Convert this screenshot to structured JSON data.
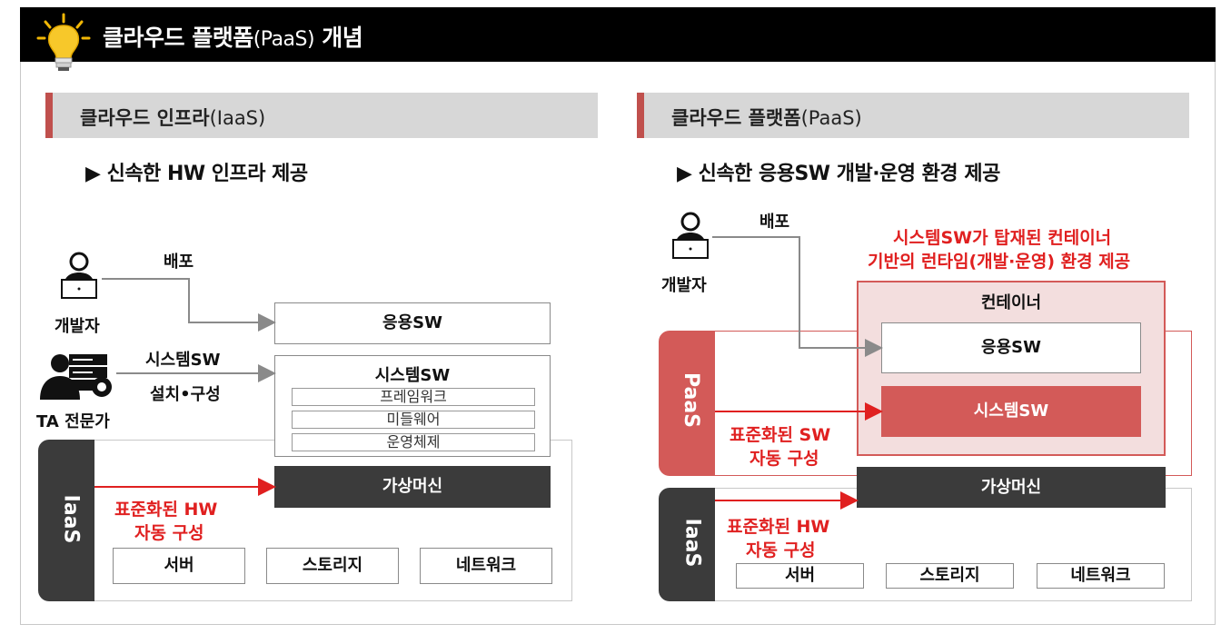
{
  "title": {
    "main": "클라우드 플랫폼",
    "suffix": "(PaaS)",
    "tail": " 개념"
  },
  "left": {
    "header_main": "클라우드 인프라",
    "header_suffix": "(IaaS)",
    "bullet": "▶ 신속한 HW 인프라 제공",
    "developer_label": "개발자",
    "deploy_label": "배포",
    "ta_label": "TA 전문가",
    "sysw_install_line1": "시스템SW",
    "sysw_install_line2": "설치•구성",
    "app_sw": "응용SW",
    "system_sw": "시스템SW",
    "sub_items": [
      "프레임워크",
      "미들웨어",
      "운영체제"
    ],
    "vm": "가상머신",
    "std_line1": "표준화된 HW",
    "std_line2": "자동 구성",
    "iaas_tab": "IaaS",
    "hw": [
      "서버",
      "스토리지",
      "네트워크"
    ]
  },
  "right": {
    "header_main": "클라우드 플랫폼",
    "header_suffix": "(PaaS)",
    "bullet": "▶ 신속한 응용SW 개발·운영 환경 제공",
    "deploy_label": "배포",
    "developer_label": "개발자",
    "note_line1": "시스템SW가 탑재된 컨테이너",
    "note_line2": "기반의 런타임(개발·운영) 환경 제공",
    "container": "컨테이너",
    "app_sw": "응용SW",
    "system_sw": "시스템SW",
    "paas_tab": "PaaS",
    "std_sw_line1": "표준화된 SW",
    "std_sw_line2": "자동 구성",
    "vm": "가상머신",
    "iaas_tab": "IaaS",
    "std_hw_line1": "표준화된 HW",
    "std_hw_line2": "자동 구성",
    "hw": [
      "서버",
      "스토리지",
      "네트워크"
    ]
  },
  "colors": {
    "accent": "#c0504d",
    "red_text": "#e02020",
    "dark": "#3b3b3b",
    "paas_fill": "#f3dede"
  }
}
